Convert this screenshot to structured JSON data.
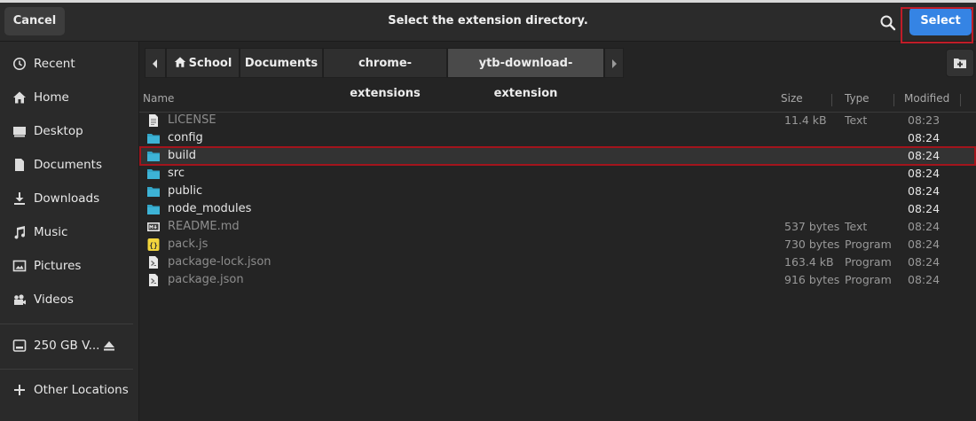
{
  "dialog": {
    "title": "Select the extension directory.",
    "cancel_label": "Cancel",
    "select_label": "Select"
  },
  "sidebar": {
    "items": [
      {
        "label": "Recent",
        "icon": "clock-icon"
      },
      {
        "label": "Home",
        "icon": "home-icon"
      },
      {
        "label": "Desktop",
        "icon": "desktop-icon"
      },
      {
        "label": "Documents",
        "icon": "document-icon"
      },
      {
        "label": "Downloads",
        "icon": "download-icon"
      },
      {
        "label": "Music",
        "icon": "music-icon"
      },
      {
        "label": "Pictures",
        "icon": "picture-icon"
      },
      {
        "label": "Videos",
        "icon": "video-icon"
      }
    ],
    "drive": {
      "label": "250 GB V...",
      "icon": "drive-icon"
    },
    "other": {
      "label": "Other Locations",
      "icon": "plus-icon"
    }
  },
  "pathbar": {
    "crumbs": [
      "School",
      "Documents",
      "chrome-extensions",
      "ytb-download-extension"
    ]
  },
  "columns": {
    "name": "Name",
    "size": "Size",
    "type": "Type",
    "modified": "Modified"
  },
  "files": [
    {
      "name": "LICENSE",
      "size": "11.4 kB",
      "type": "Text",
      "modified": "08:23",
      "icon": "text-file-icon"
    },
    {
      "name": "config",
      "size": "",
      "type": "",
      "modified": "08:24",
      "icon": "folder-icon"
    },
    {
      "name": "build",
      "size": "",
      "type": "",
      "modified": "08:24",
      "icon": "folder-icon"
    },
    {
      "name": "src",
      "size": "",
      "type": "",
      "modified": "08:24",
      "icon": "folder-icon"
    },
    {
      "name": "public",
      "size": "",
      "type": "",
      "modified": "08:24",
      "icon": "folder-icon"
    },
    {
      "name": "node_modules",
      "size": "",
      "type": "",
      "modified": "08:24",
      "icon": "folder-icon"
    },
    {
      "name": "README.md",
      "size": "537 bytes",
      "type": "Text",
      "modified": "08:24",
      "icon": "markdown-file-icon"
    },
    {
      "name": "pack.js",
      "size": "730 bytes",
      "type": "Program",
      "modified": "08:24",
      "icon": "javascript-file-icon"
    },
    {
      "name": "package-lock.json",
      "size": "163.4 kB",
      "type": "Program",
      "modified": "08:24",
      "icon": "script-file-icon"
    },
    {
      "name": "package.json",
      "size": "916 bytes",
      "type": "Program",
      "modified": "08:24",
      "icon": "script-file-icon"
    }
  ],
  "colors": {
    "accent": "#3584e4",
    "folder": "#33a5c7",
    "highlight_outline": "#c01c28"
  }
}
